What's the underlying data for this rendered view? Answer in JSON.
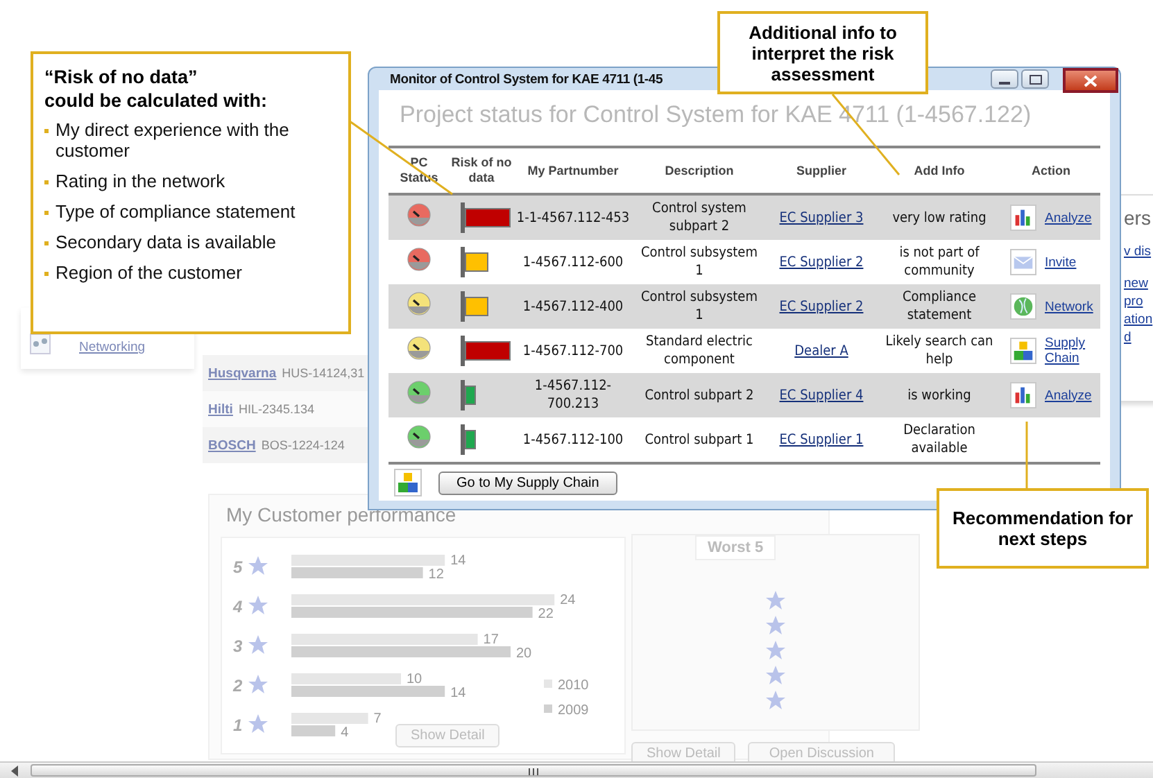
{
  "background": {
    "networking_link": "Networking",
    "supplier_rows": [
      {
        "name": "Husqvarna",
        "part": "HUS-14124,31"
      },
      {
        "name": "Hilti",
        "part": "HIL-2345.134"
      },
      {
        "name": "BOSCH",
        "part": "BOS-1224-124"
      }
    ],
    "side_panel": {
      "title": "ers",
      "links": [
        "v dis",
        "new",
        "pro",
        "ation",
        "d"
      ]
    },
    "performance": {
      "title": "My Customer performance",
      "show_detail": "Show Detail",
      "chart_data": {
        "type": "bar",
        "orientation": "horizontal",
        "categories": [
          "5",
          "4",
          "3",
          "2",
          "1"
        ],
        "data_labels": true,
        "legend": "right",
        "series": [
          {
            "name": "2010",
            "color": "#e6e6e6",
            "values": [
              14,
              24,
              17,
              10,
              7
            ]
          },
          {
            "name": "2009",
            "color": "#d0d0d0",
            "values": [
              12,
              22,
              20,
              14,
              4
            ]
          }
        ]
      }
    },
    "worst": {
      "title": "Worst 5",
      "buttons": [
        "Show Detail",
        "Open Discussion"
      ]
    }
  },
  "window": {
    "title": "Monitor of Control System for KAE 4711 (1-45",
    "heading": "Project status for Control System for KAE 4711 (1-4567.122)",
    "columns": [
      "PC Status",
      "Risk of no data",
      "My Partnumber",
      "Description",
      "Supplier",
      "Add Info",
      "Action"
    ],
    "rows": [
      {
        "pc_status": {
          "color": "#e86a60"
        },
        "risk": {
          "kind": "high",
          "color": "#c00000"
        },
        "part": "1-1-4567.112-453",
        "description": "Control system subpart 2",
        "supplier": "EC Supplier 3",
        "info": "very low rating",
        "action": {
          "kind": "chart",
          "label": "Analyze"
        }
      },
      {
        "pc_status": {
          "color": "#e86a60"
        },
        "risk": {
          "kind": "medium",
          "color": "#ffc000"
        },
        "part": "1-4567.112-600",
        "description": "Control subsystem 1",
        "supplier": "EC Supplier 2",
        "info": "is not part of community",
        "action": {
          "kind": "mail",
          "label": "Invite"
        }
      },
      {
        "pc_status": {
          "color": "#f4e27a"
        },
        "risk": {
          "kind": "medium",
          "color": "#ffc000"
        },
        "part": "1-4567.112-400",
        "description": "Control subsystem 1",
        "supplier": "EC Supplier 2",
        "info": "Compliance statement",
        "action": {
          "kind": "globe",
          "label": "Network"
        }
      },
      {
        "pc_status": {
          "color": "#f4e27a"
        },
        "risk": {
          "kind": "high",
          "color": "#c00000"
        },
        "part": "1-4567.112-700",
        "description": "Standard electric component",
        "supplier": "Dealer A",
        "info": "Likely search can help",
        "action": {
          "kind": "blocks",
          "label": "Supply Chain"
        }
      },
      {
        "pc_status": {
          "color": "#6ccf6c"
        },
        "risk": {
          "kind": "low",
          "color": "#1fa84f"
        },
        "part": "1-4567.112-700.213",
        "description": "Control subpart 2",
        "supplier": "EC Supplier 4",
        "info": "is working",
        "action": {
          "kind": "chart",
          "label": "Analyze"
        }
      },
      {
        "pc_status": {
          "color": "#6ccf6c"
        },
        "risk": {
          "kind": "low",
          "color": "#1fa84f"
        },
        "part": "1-4567.112-100",
        "description": "Control subpart 1",
        "supplier": "EC Supplier 1",
        "info": "Declaration available"
      }
    ],
    "footer_button": "Go to My Supply Chain"
  },
  "callouts": [
    {
      "kind": "list",
      "title_lines": [
        "“Risk of no data”",
        "could be calculated with:"
      ],
      "items": [
        "My direct experience with the customer",
        "Rating in the network",
        "Type of compliance statement",
        "Secondary data is available",
        "Region of the customer"
      ]
    },
    {
      "kind": "note",
      "text": "Additional info to interpret the risk assessment"
    },
    {
      "kind": "note",
      "text": "Recommendation for next steps"
    }
  ]
}
